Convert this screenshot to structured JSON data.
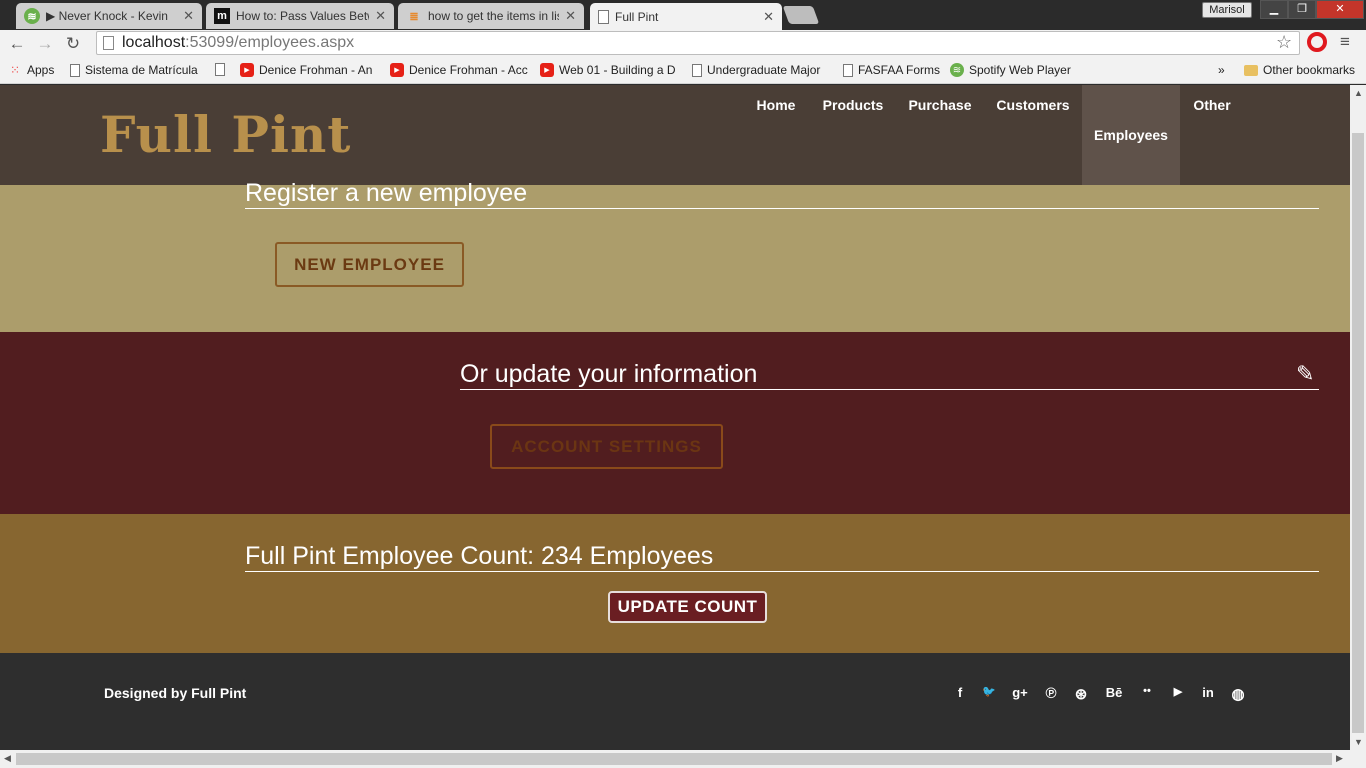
{
  "browser": {
    "tabs": [
      {
        "title": "▶ Never Knock - Kevin",
        "icon": "spotify-icon",
        "color": "#6ab04c"
      },
      {
        "title": "How to: Pass Values Betw",
        "icon": "m-icon",
        "color": "#111111"
      },
      {
        "title": "how to get the items in lis",
        "icon": "stackoverflow-icon",
        "color": "#e68a2e"
      },
      {
        "title": "Full Pint",
        "icon": "page-icon",
        "color": "#ffffff"
      }
    ],
    "user": "Marisol",
    "url_host": "localhost",
    "url_path": ":53099/employees.aspx",
    "bookmarks": [
      {
        "label": "Apps",
        "icon": "apps-icon"
      },
      {
        "label": "Sistema de Matrícula",
        "icon": "page-icon"
      },
      {
        "label": "Denice Frohman - An",
        "icon": "youtube-icon"
      },
      {
        "label": "Denice Frohman - Acc",
        "icon": "youtube-icon"
      },
      {
        "label": "Web 01 - Building a D",
        "icon": "youtube-icon"
      },
      {
        "label": "Undergraduate Major",
        "icon": "page-icon"
      },
      {
        "label": "FASFAA Forms",
        "icon": "page-icon"
      },
      {
        "label": "Spotify Web Player",
        "icon": "spotify-icon"
      }
    ],
    "overflow_label": "»",
    "other_bookmarks": "Other bookmarks"
  },
  "site": {
    "logo": "Full Pint",
    "nav": [
      "Home",
      "Products",
      "Purchase",
      "Customers",
      "Employees",
      "Other"
    ],
    "active_nav": "Employees"
  },
  "register": {
    "title": "Register a new employee",
    "button": "NEW EMPLOYEE"
  },
  "update": {
    "title": "Or update your information",
    "button": "ACCOUNT SETTINGS"
  },
  "count": {
    "title": "Full Pint Employee Count: 234 Employees",
    "button": "UPDATE COUNT"
  },
  "footer": {
    "text": "Designed by Full Pint",
    "social": [
      {
        "name": "facebook-icon",
        "glyph": "f"
      },
      {
        "name": "twitter-icon",
        "glyph": "🐦"
      },
      {
        "name": "google-plus-icon",
        "glyph": "g+"
      },
      {
        "name": "pinterest-icon",
        "glyph": "℗"
      },
      {
        "name": "dribbble-icon",
        "glyph": "⊛"
      },
      {
        "name": "behance-icon",
        "glyph": "Bē"
      },
      {
        "name": "flickr-icon",
        "glyph": "••"
      },
      {
        "name": "youtube-icon",
        "glyph": "▶"
      },
      {
        "name": "linkedin-icon",
        "glyph": "in"
      },
      {
        "name": "github-icon",
        "glyph": "◍"
      }
    ]
  },
  "colors": {
    "header": "#4a3e36",
    "register_bg": "#ac9d6b",
    "update_bg": "#511d1f",
    "count_bg": "#876630",
    "footer_bg": "#2e2e2e",
    "logo": "#b8904c",
    "register_btn": "#6b3a12",
    "update_btn": "#8a4a1a"
  }
}
